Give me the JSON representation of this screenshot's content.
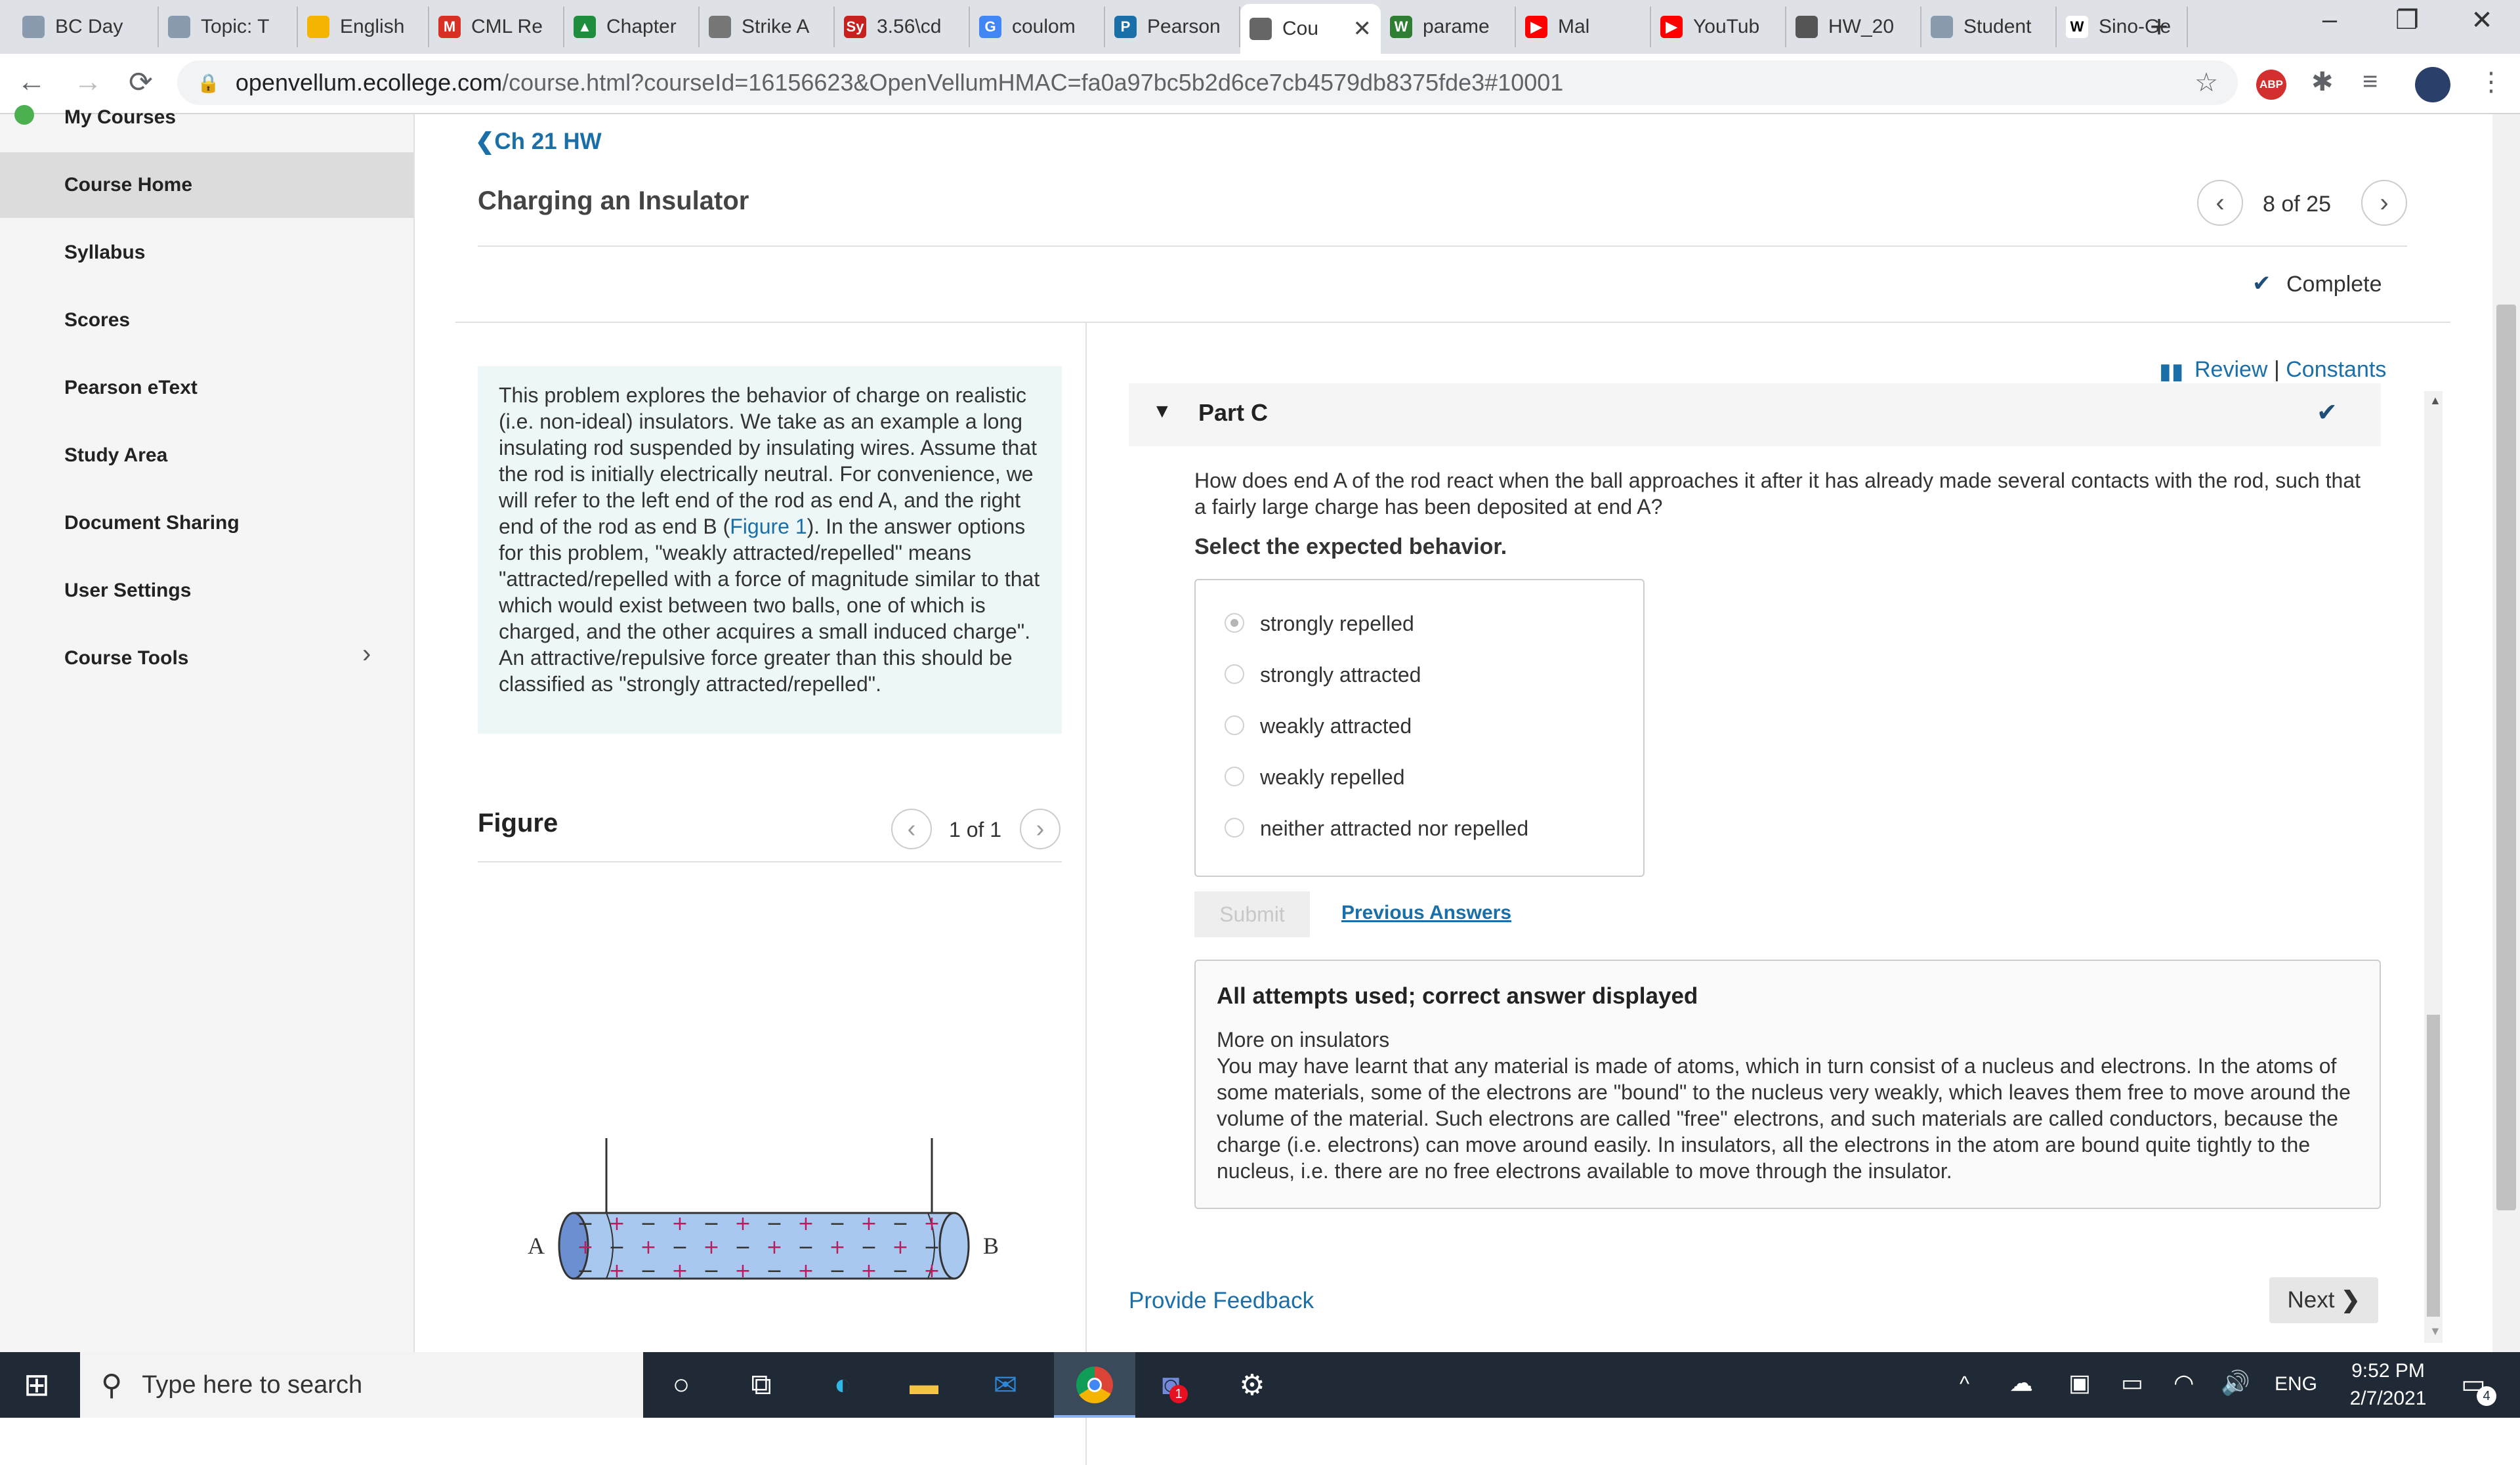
{
  "browser": {
    "tabs": [
      {
        "label": "BC Day",
        "color": "#8a9bb0",
        "glyph": ""
      },
      {
        "label": "Topic: T",
        "color": "#8a9bb0",
        "glyph": ""
      },
      {
        "label": "English",
        "color": "#f4b400",
        "glyph": ""
      },
      {
        "label": "CML Re",
        "color": "#d93025",
        "glyph": "M"
      },
      {
        "label": "Chapter",
        "color": "#1e8e3e",
        "glyph": "▲"
      },
      {
        "label": "Strike A",
        "color": "#777777",
        "glyph": ""
      },
      {
        "label": "3.56\\cd",
        "color": "#c5221f",
        "glyph": "Sy"
      },
      {
        "label": "coulom",
        "color": "#4285f4",
        "glyph": "G"
      },
      {
        "label": "Pearson",
        "color": "#1b6fa8",
        "glyph": "P"
      },
      {
        "label": "Cou",
        "color": "#666666",
        "glyph": ""
      },
      {
        "label": "parame",
        "color": "#2e7d32",
        "glyph": "W"
      },
      {
        "label": "Mal",
        "color": "#ff0000",
        "glyph": "▶"
      },
      {
        "label": "YouTub",
        "color": "#ff0000",
        "glyph": "▶"
      },
      {
        "label": "HW_20",
        "color": "#555555",
        "glyph": ""
      },
      {
        "label": "Student",
        "color": "#8a9bb0",
        "glyph": ""
      },
      {
        "label": "Sino-Ge",
        "color": "#ffffff",
        "glyph": "W"
      }
    ],
    "new_tab": "+",
    "url_host": "openvellum.ecollege.com",
    "url_path": "/course.html?courseId=16156623&OpenVellumHMAC=fa0a97bc5b2d6ce7cb4579db8375fde3#10001",
    "abp_label": "ABP"
  },
  "sidebar": {
    "cut_item": "My Courses",
    "items": [
      {
        "label": "Course Home"
      },
      {
        "label": "Syllabus"
      },
      {
        "label": "Scores"
      },
      {
        "label": "Pearson eText"
      },
      {
        "label": "Study Area"
      },
      {
        "label": "Document Sharing"
      },
      {
        "label": "User Settings"
      },
      {
        "label": "Course Tools"
      }
    ]
  },
  "header": {
    "back_link": "Ch 21 HW",
    "title": "Charging an Insulator",
    "pager": "8 of 25",
    "status": "Complete"
  },
  "problem": {
    "intro_pre": "This problem explores the behavior of charge on realistic (i.e. non-ideal) insulators. We take as an example a long insulating rod suspended by insulating wires. Assume that the rod is initially electrically neutral. For convenience, we will refer to the left end of the rod as end A, and the right end of the rod as end B (",
    "intro_link": "Figure 1",
    "intro_post": "). In the answer options for this problem, \"weakly attracted/repelled\" means \"attracted/repelled with a force of magnitude similar to that which would exist between two balls, one of which is charged, and the other acquires a small induced charge\". An attractive/repulsive force greater than this should be classified as \"strongly attracted/repelled\".",
    "figure_title": "Figure",
    "figure_pager": "1 of 1",
    "figure_label_a": "A",
    "figure_label_b": "B"
  },
  "part": {
    "review": "Review",
    "separator": "|",
    "constants": "Constants",
    "label": "Part C",
    "question": "How does end A of the rod react when the ball approaches it after it has already made several contacts with the rod, such that a fairly large charge has been deposited at end A?",
    "instruction": "Select the expected behavior.",
    "options": [
      {
        "label": "strongly repelled",
        "selected": true
      },
      {
        "label": "strongly attracted",
        "selected": false
      },
      {
        "label": "weakly attracted",
        "selected": false
      },
      {
        "label": "weakly repelled",
        "selected": false
      },
      {
        "label": "neither attracted nor repelled",
        "selected": false
      }
    ],
    "submit": "Submit",
    "previous_answers": "Previous Answers",
    "result_title": "All attempts used; correct answer displayed",
    "more_title": "More on insulators",
    "more_text": "You may have learnt that any material is made of atoms, which in turn consist of a nucleus and electrons. In the atoms of some materials, some of the electrons are \"bound\" to the nucleus very weakly, which leaves them free to move around the volume of the material. Such electrons are called \"free\" electrons, and such materials are called conductors, because the charge (i.e. electrons) can move around easily. In insulators, all the electrons in the atom are bound quite tightly to the nucleus, i.e. there are no free electrons available to move through the insulator.",
    "feedback": "Provide Feedback",
    "next": "Next"
  },
  "taskbar": {
    "search_placeholder": "Type here to search",
    "lang": "ENG",
    "time": "9:52 PM",
    "date": "2/7/2021",
    "notif_count": "4",
    "discord_badge": "1"
  },
  "colors": {
    "accent": "#1b6fa8",
    "check": "#1f4e79",
    "panel": "#eef7f7"
  }
}
